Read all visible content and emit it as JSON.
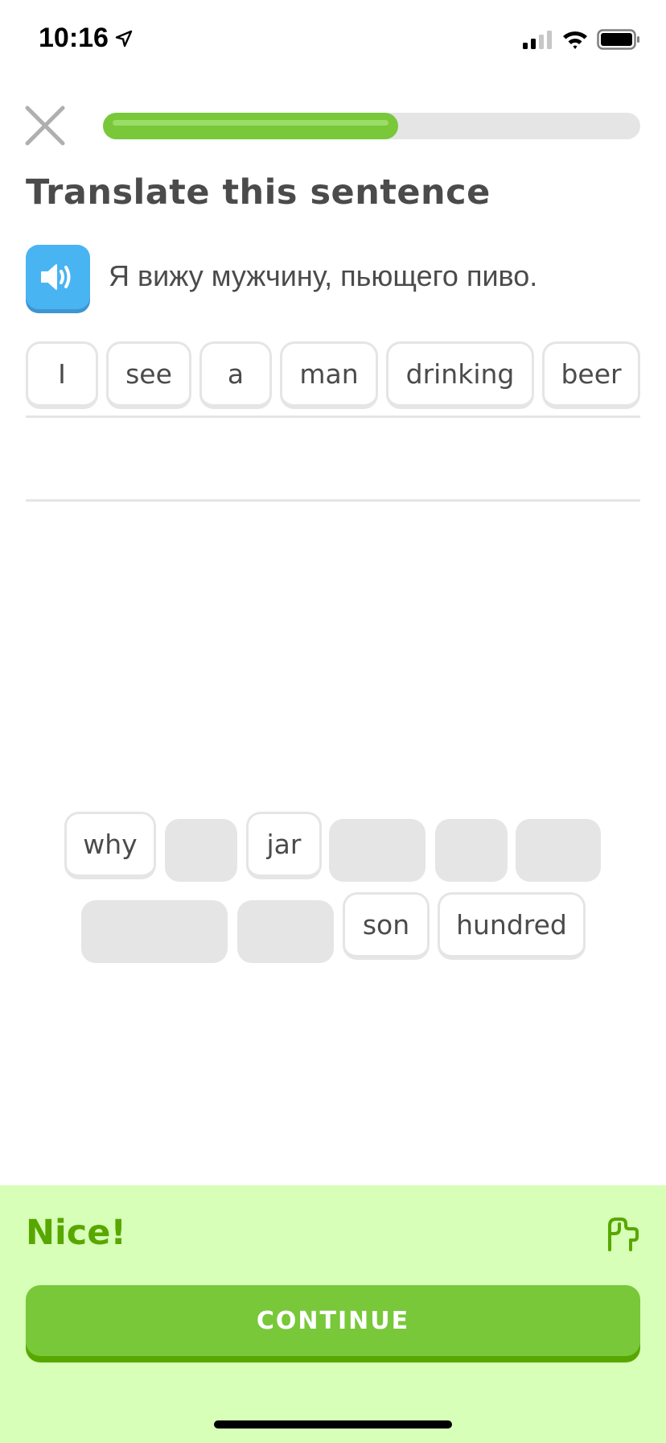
{
  "status": {
    "time": "10:16",
    "icons": [
      "location-arrow-icon",
      "cellular-signal-icon",
      "wifi-icon",
      "battery-icon"
    ]
  },
  "lesson": {
    "close_icon": "close-icon",
    "progress": 0.55,
    "title": "Translate this sentence",
    "prompt": "Я вижу мужчину, пьющего пиво.",
    "speaker_icon": "speaker-icon"
  },
  "answer": {
    "words": [
      "I",
      "see",
      "a",
      "man",
      "drinking",
      "beer"
    ]
  },
  "bank": {
    "row1": [
      "why",
      "",
      "jar",
      "",
      "",
      ""
    ],
    "row2": [
      "",
      "",
      "son",
      "hundred"
    ]
  },
  "feedback": {
    "message": "Nice!",
    "flag_icon": "flag-icon",
    "continue_label": "CONTINUE"
  },
  "colors": {
    "accent_green": "#78c83a",
    "feedback_bg": "#d7ffb8",
    "feedback_text": "#58a700",
    "speaker_blue": "#49b4f2",
    "tile_border": "#e5e5e5"
  }
}
